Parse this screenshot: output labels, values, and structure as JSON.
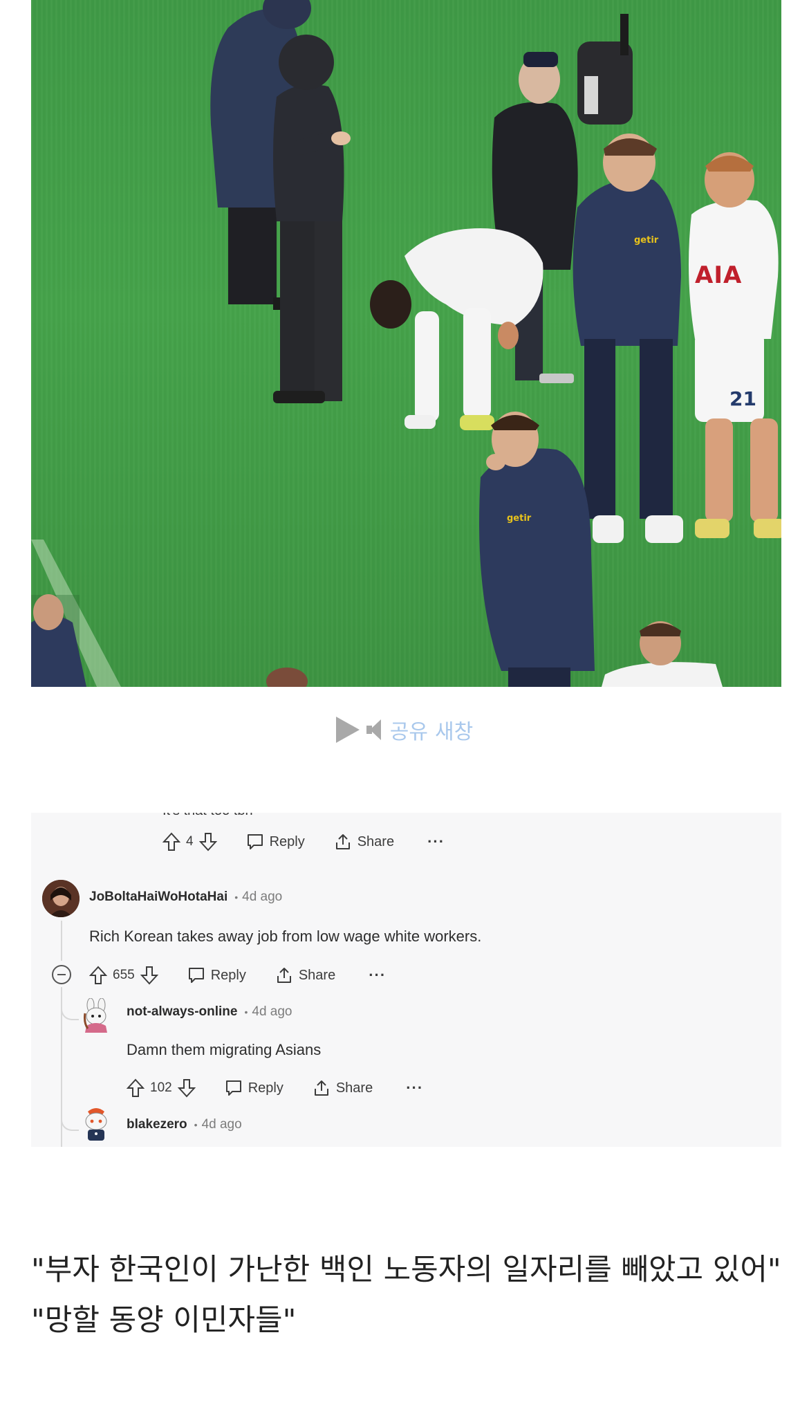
{
  "video": {
    "jersey_sponsor": "AIA",
    "kit_sponsor": "getir",
    "player_number": "21"
  },
  "player_controls": {
    "play_icon": "play-icon",
    "mute_icon": "speaker-icon",
    "share_label": "공유",
    "new_window_label": "새창"
  },
  "reddit": {
    "clipped_text": "It's that too tbh",
    "actions": {
      "reply": "Reply",
      "share": "Share",
      "more": "···"
    },
    "top_action_score": "4",
    "comments": [
      {
        "author": "JoBoltaHaiWoHotaHai",
        "separator": "•",
        "time": "4d ago",
        "body": "Rich Korean takes away job from low wage white workers.",
        "score": "655"
      },
      {
        "author": "not-always-online",
        "separator": "•",
        "time": "4d ago",
        "body": "Damn them migrating Asians",
        "score": "102"
      },
      {
        "author": "blakezero",
        "separator": "•",
        "time": "4d ago"
      }
    ]
  },
  "caption": {
    "line1": " \"부자 한국인이 가난한 백인 노동자의 일자리를 빼았고 있어\"",
    "line2": " \"망할 동양 이민자들\""
  }
}
